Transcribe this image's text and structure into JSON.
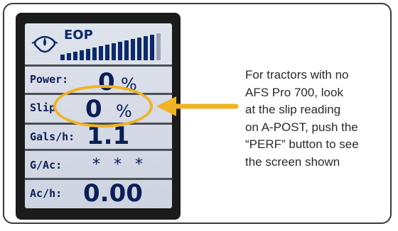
{
  "display": {
    "eop_label": "EOP",
    "rows": [
      {
        "label": "Power:",
        "value": "0",
        "unit": "%"
      },
      {
        "label": "Slip",
        "value": "0",
        "unit": "%"
      },
      {
        "label": "Gals/h:",
        "value": "1.1",
        "unit": ""
      },
      {
        "label": "G/Ac:",
        "value": "* * *",
        "unit": ""
      },
      {
        "label": "Ac/h:",
        "value": "0.00",
        "unit": ""
      }
    ]
  },
  "caption": {
    "lines": [
      "For tractors with no",
      "AFS Pro 700, look",
      "at the slip reading",
      "on A-POST, push the",
      "“PERF” button to see",
      "the screen shown"
    ]
  },
  "colors": {
    "highlight": "#f0b323",
    "lcd_text": "#0a1f55",
    "lcd_background": "#dfe3ec"
  },
  "icons": {
    "engine_oil": "oil-can-icon"
  }
}
